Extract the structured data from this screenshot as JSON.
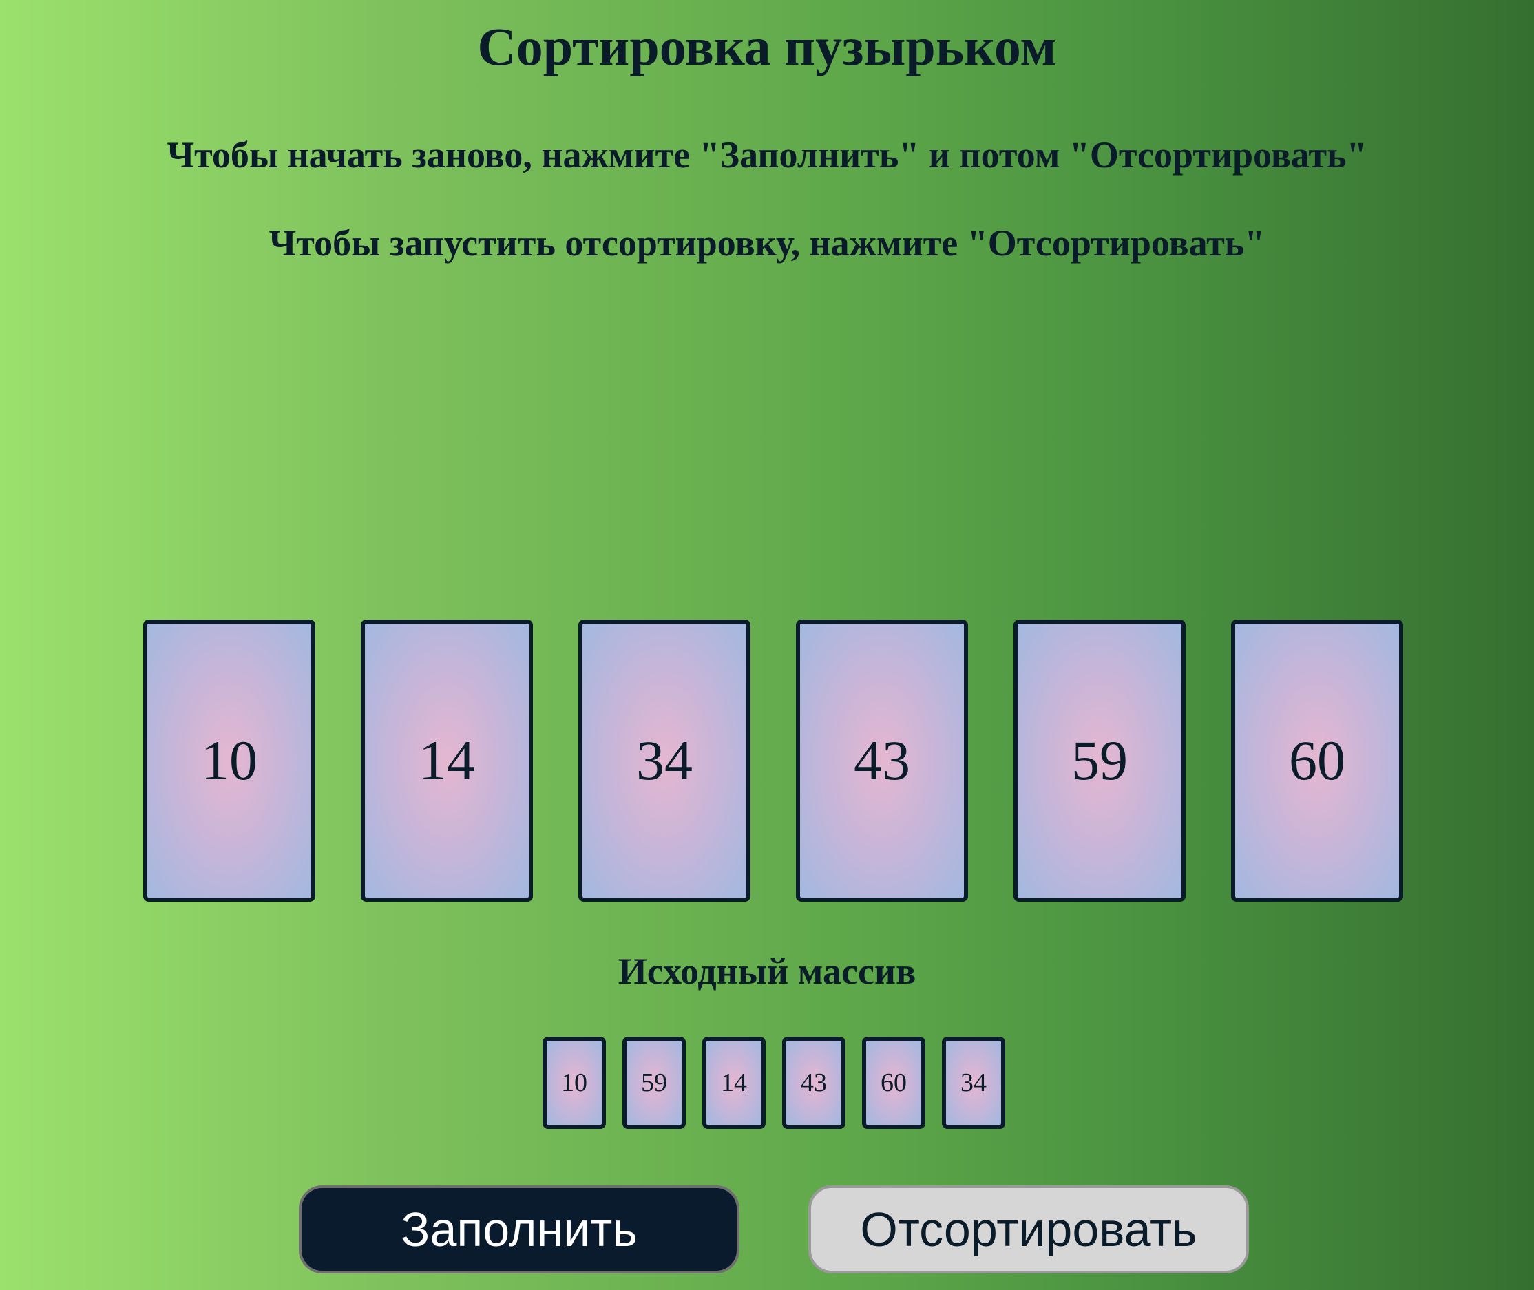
{
  "title": "Сортировка пузырьком",
  "hints": [
    "Чтобы начать заново, нажмите \"Заполнить\" и потом \"Отсортировать\"",
    "Чтобы запустить отсортировку, нажмите \"Отсортировать\""
  ],
  "sorted_cards": [
    "10",
    "14",
    "34",
    "43",
    "59",
    "60"
  ],
  "source_label": "Исходный массив",
  "source_cards": [
    "10",
    "59",
    "14",
    "43",
    "60",
    "34"
  ],
  "buttons": {
    "fill_label": "Заполнить",
    "sort_label": "Отсортировать"
  },
  "colors": {
    "text": "#0a1b2a",
    "fill_button_bg": "#0a1b2e",
    "sort_button_bg": "#d6d6d6"
  }
}
